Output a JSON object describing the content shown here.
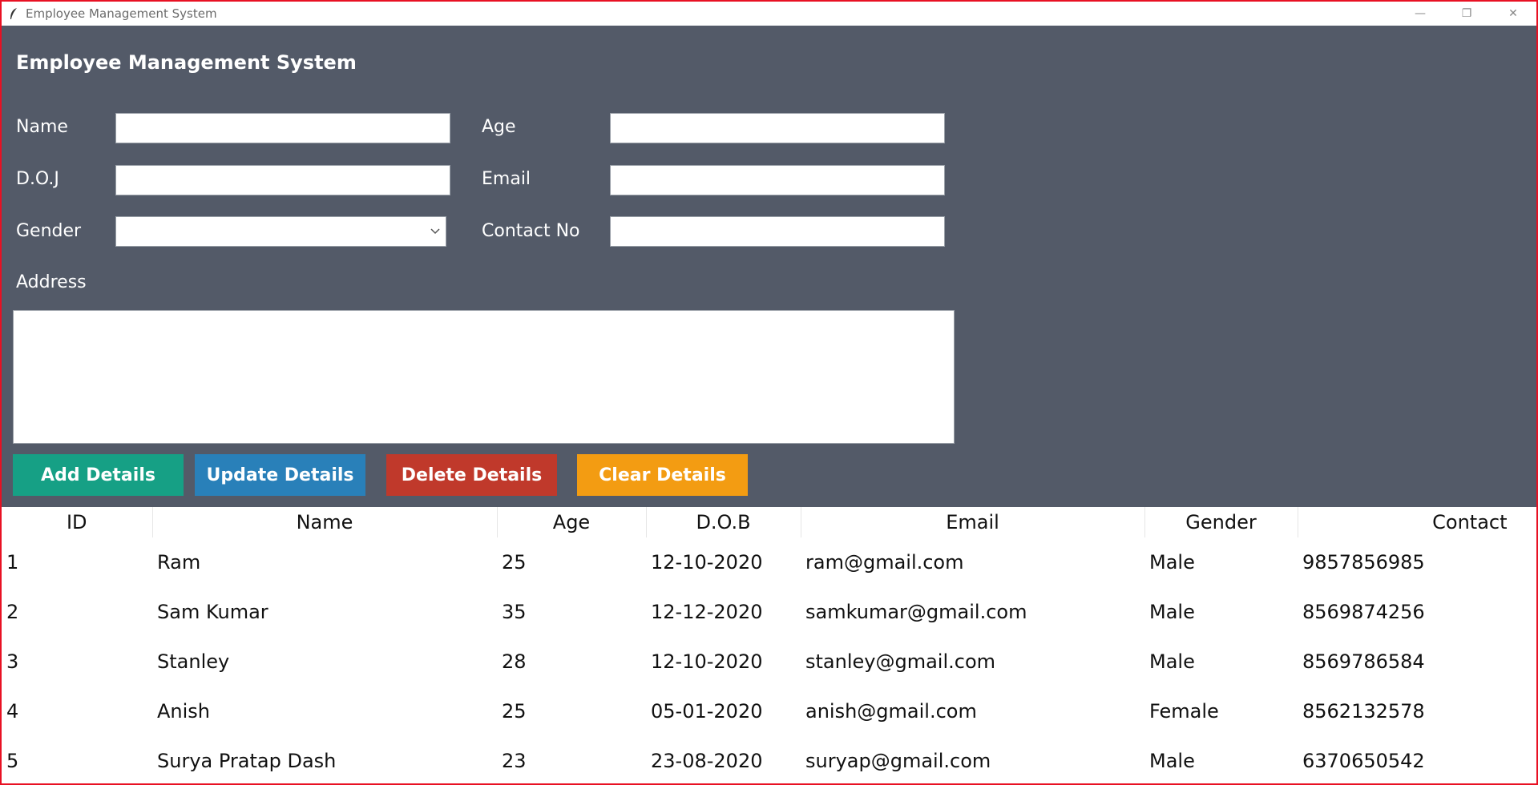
{
  "window": {
    "title": "Employee Management System",
    "controls": {
      "minimize": "—",
      "restore": "❐",
      "close": "✕"
    }
  },
  "form": {
    "heading": "Employee Management System",
    "labels": {
      "name": "Name",
      "age": "Age",
      "doj": "D.O.J",
      "email": "Email",
      "gender": "Gender",
      "contact": "Contact No",
      "address": "Address"
    },
    "values": {
      "name": "",
      "age": "",
      "doj": "",
      "email": "",
      "gender": "",
      "contact": "",
      "address": ""
    }
  },
  "buttons": {
    "add": "Add Details",
    "update": "Update Details",
    "delete": "Delete Details",
    "clear": "Clear Details"
  },
  "colors": {
    "panel_bg": "#535a68",
    "add": "#16a085",
    "update": "#2980b9",
    "delete": "#c0392b",
    "clear": "#f39c12",
    "window_border": "#e81123"
  },
  "table": {
    "headers": [
      "ID",
      "Name",
      "Age",
      "D.O.B",
      "Email",
      "Gender",
      "Contact"
    ],
    "rows": [
      [
        "1",
        "Ram",
        "25",
        "12-10-2020",
        "ram@gmail.com",
        "Male",
        "9857856985"
      ],
      [
        "2",
        "Sam Kumar",
        "35",
        "12-12-2020",
        "samkumar@gmail.com",
        "Male",
        "8569874256"
      ],
      [
        "3",
        "Stanley",
        "28",
        "12-10-2020",
        "stanley@gmail.com",
        "Male",
        "8569786584"
      ],
      [
        "4",
        "Anish",
        "25",
        "05-01-2020",
        "anish@gmail.com",
        "Female",
        "8562132578"
      ],
      [
        "5",
        "Surya Pratap Dash",
        "23",
        "23-08-2020",
        "suryap@gmail.com",
        "Male",
        "6370650542"
      ]
    ]
  }
}
